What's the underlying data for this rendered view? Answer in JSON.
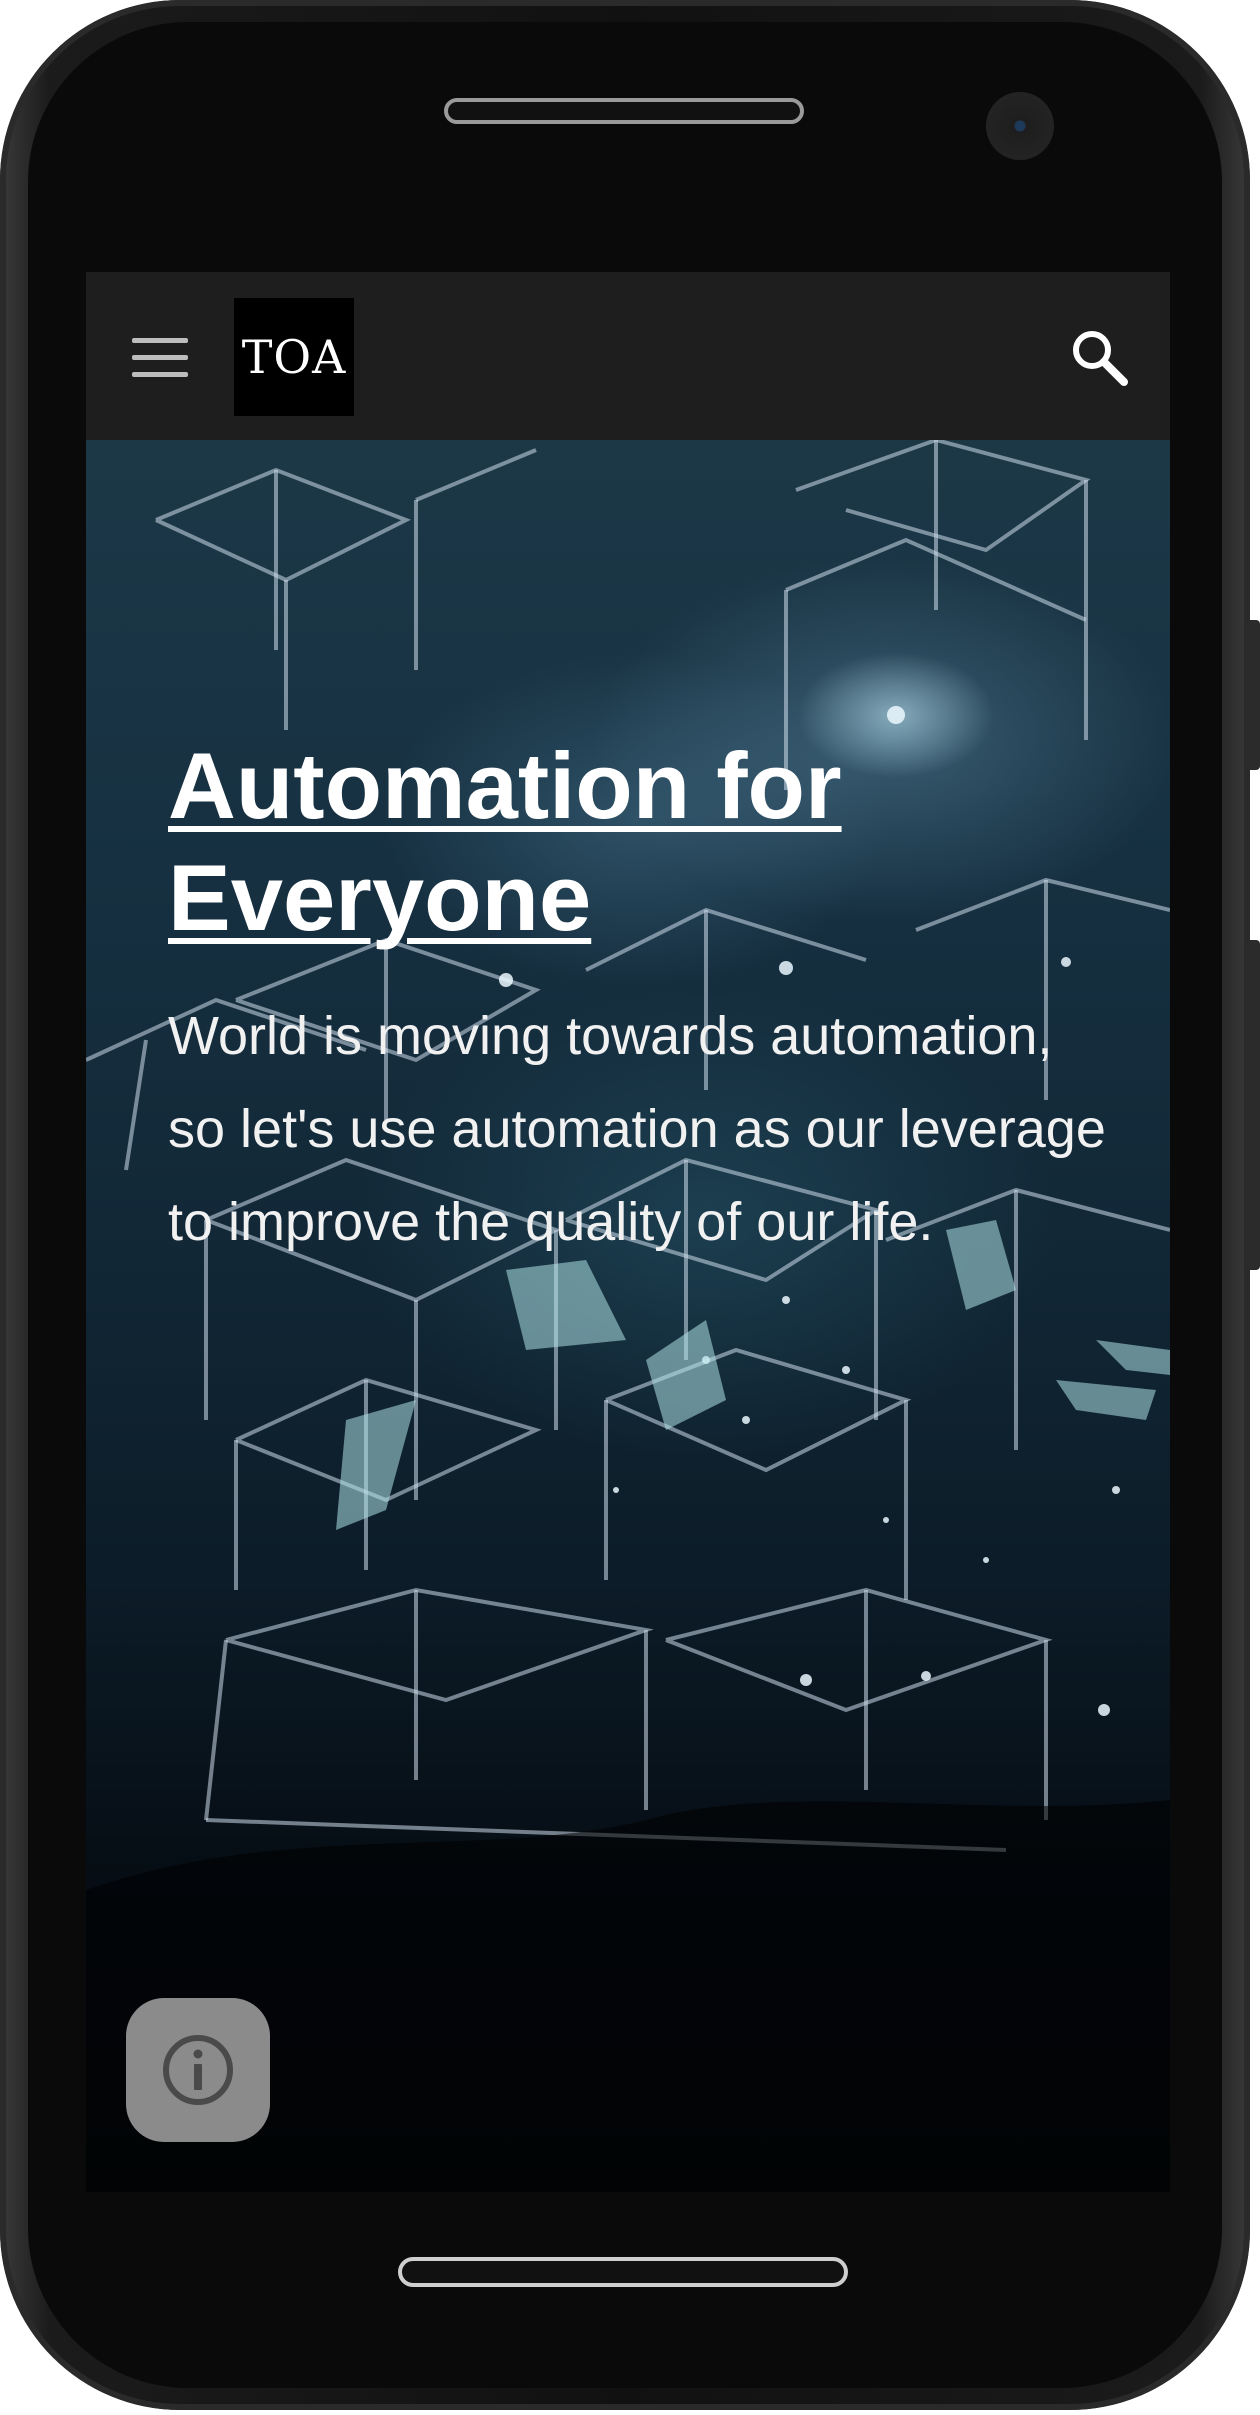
{
  "header": {
    "logo_text": "TOA",
    "menu_icon": "hamburger-menu-icon",
    "search_icon": "search-icon"
  },
  "hero": {
    "title": "Automation for Everyone",
    "subtitle": "World is moving towards automation, so let's use automation as our leverage to improve the quality of our life."
  },
  "floating": {
    "info_icon": "info-icon"
  },
  "colors": {
    "topbar": "#1e1e1e",
    "logo_bg": "#000000",
    "text": "#ffffff",
    "info_button": "#8b8b8b"
  }
}
